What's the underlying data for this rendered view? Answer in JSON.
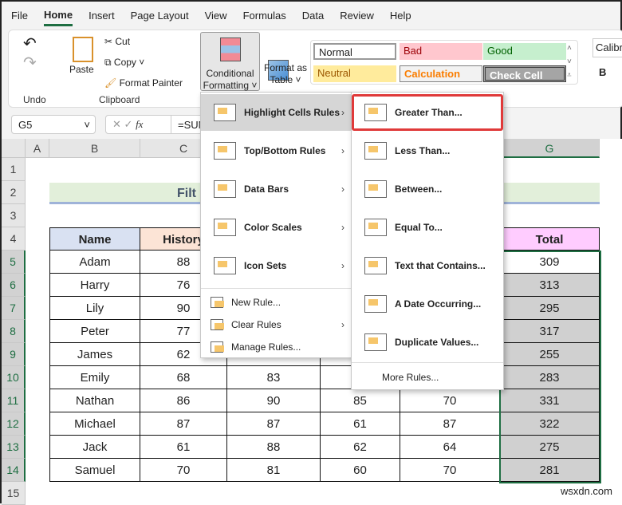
{
  "tabs": [
    "File",
    "Home",
    "Insert",
    "Page Layout",
    "View",
    "Formulas",
    "Data",
    "Review",
    "Help"
  ],
  "ribbon": {
    "undo_label": "Undo",
    "paste": "Paste",
    "cut": "Cut",
    "copy": "Copy",
    "format_painter": "Format Painter",
    "clipboard_label": "Clipboard",
    "cond_fmt_1": "Conditional",
    "cond_fmt_2": "Formatting",
    "format_table_1": "Format as",
    "format_table_2": "Table",
    "styles": {
      "normal": "Normal",
      "bad": "Bad",
      "good": "Good",
      "neutral": "Neutral",
      "calculation": "Calculation",
      "check_cell": "Check Cell"
    },
    "font": "Calibri",
    "bold": "B"
  },
  "formula_bar": {
    "name_box": "G5",
    "formula": "=SUM",
    "fx": "fx"
  },
  "columns": [
    "A",
    "B",
    "C",
    "G"
  ],
  "rows": [
    "1",
    "2",
    "3",
    "4",
    "5",
    "6",
    "7",
    "8",
    "9",
    "10",
    "11",
    "12",
    "13",
    "14",
    "15"
  ],
  "title_partial": "Filt",
  "headers": {
    "name": "Name",
    "history": "History",
    "total": "Total"
  },
  "data": [
    {
      "name": "Adam",
      "history": "88",
      "d": "",
      "e": "",
      "f": "",
      "total": "309"
    },
    {
      "name": "Harry",
      "history": "76",
      "d": "",
      "e": "",
      "f": "",
      "total": "313"
    },
    {
      "name": "Lily",
      "history": "90",
      "d": "",
      "e": "",
      "f": "",
      "total": "295"
    },
    {
      "name": "Peter",
      "history": "77",
      "d": "",
      "e": "",
      "f": "",
      "total": "317"
    },
    {
      "name": "James",
      "history": "62",
      "d": "",
      "e": "",
      "f": "",
      "total": "255"
    },
    {
      "name": "Emily",
      "history": "68",
      "d": "83",
      "e": "",
      "f": "",
      "total": "283"
    },
    {
      "name": "Nathan",
      "history": "86",
      "d": "90",
      "e": "85",
      "f": "70",
      "total": "331"
    },
    {
      "name": "Michael",
      "history": "87",
      "d": "87",
      "e": "61",
      "f": "87",
      "total": "322"
    },
    {
      "name": "Jack",
      "history": "61",
      "d": "88",
      "e": "62",
      "f": "64",
      "total": "275"
    },
    {
      "name": "Samuel",
      "history": "70",
      "d": "81",
      "e": "60",
      "f": "70",
      "total": "281"
    }
  ],
  "cf_menu": [
    "Highlight Cells Rules",
    "Top/Bottom Rules",
    "Data Bars",
    "Color Scales",
    "Icon Sets"
  ],
  "cf_small": [
    "New Rule...",
    "Clear Rules",
    "Manage Rules..."
  ],
  "hcr_menu": [
    "Greater Than...",
    "Less Than...",
    "Between...",
    "Equal To...",
    "Text that Contains...",
    "A Date Occurring...",
    "Duplicate Values..."
  ],
  "more_rules": "More Rules...",
  "watermark": "wsxdn.com"
}
